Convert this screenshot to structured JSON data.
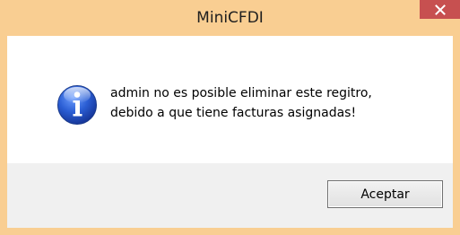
{
  "window": {
    "title": "MiniCFDI",
    "close_glyph": "✕"
  },
  "dialog": {
    "icon": "info-icon",
    "message": "admin no es posible eliminar este regitro,\n debido a que tiene facturas asignadas!",
    "ok_label": "Aceptar"
  },
  "colors": {
    "titlebar": "#f9ce92",
    "close_button": "#c75050",
    "content_bg": "#ffffff",
    "footer_bg": "#f0f0f0",
    "icon_blue": "#1f4fc2"
  }
}
